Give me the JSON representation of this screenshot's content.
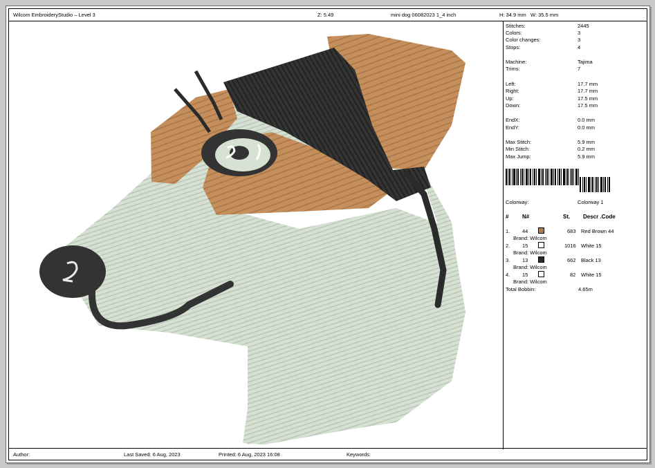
{
  "header": {
    "app_title": "Wilcom EmbroideryStudio – Level 3",
    "zoom": "Z: 5.49",
    "file_name": "mini dog 06082023 1_4  inch",
    "height": "H: 34.9 mm",
    "width": "W: 35.5 mm"
  },
  "stats": [
    {
      "label": "Stitches:",
      "value": "2445"
    },
    {
      "label": "Colors:",
      "value": "3"
    },
    {
      "label": "Color changes:",
      "value": "3"
    },
    {
      "label": "Stops:",
      "value": "4"
    },
    {
      "label": "Machine:",
      "value": "Tajima"
    },
    {
      "label": "Trims:",
      "value": "7"
    },
    {
      "label": "Left:",
      "value": "17.7 mm"
    },
    {
      "label": "Right:",
      "value": "17.7 mm"
    },
    {
      "label": "Up:",
      "value": "17.5 mm"
    },
    {
      "label": "Down:",
      "value": "17.5 mm"
    },
    {
      "label": "EndX:",
      "value": "0.0 mm"
    },
    {
      "label": "EndY:",
      "value": "0.0 mm"
    },
    {
      "label": "Max Stitch:",
      "value": "5.9 mm"
    },
    {
      "label": "Min Stitch:",
      "value": "0.2 mm"
    },
    {
      "label": "Max Jump:",
      "value": "5.9 mm"
    }
  ],
  "colorway": {
    "label": "Colorway:",
    "value": "Colorway 1"
  },
  "color_table": {
    "headers": {
      "hash": "#",
      "n": "N#",
      "st": "St.",
      "descr": "Descr .Code"
    },
    "rows": [
      {
        "idx": "1.",
        "n": "44",
        "color": "#b07a4a",
        "stitches": "683",
        "descr": "Red Brown 44",
        "brand": "Brand: Wilcom"
      },
      {
        "idx": "2.",
        "n": "15",
        "color": "#ffffff",
        "stitches": "1016",
        "descr": "White 15",
        "brand": "Brand: Wilcom"
      },
      {
        "idx": "3.",
        "n": "13",
        "color": "#2b2b2b",
        "stitches": "662",
        "descr": "Black 13",
        "brand": "Brand: Wilcom"
      },
      {
        "idx": "4.",
        "n": "15",
        "color": "#ffffff",
        "stitches": "82",
        "descr": "White 15",
        "brand": "Brand: Wilcom"
      }
    ],
    "total_bobbin_label": "Total Bobbin:",
    "total_bobbin_value": "4.65m"
  },
  "footer": {
    "author": "Author:",
    "last_saved": "Last Saved:  6 Aug, 2023",
    "printed": "Printed:  6 Aug, 2023 16:08",
    "keywords": "Keywords:"
  },
  "thread_colors": {
    "brown": "#c48f5c",
    "white": "#d9e4d6",
    "black": "#2f2f2f"
  }
}
